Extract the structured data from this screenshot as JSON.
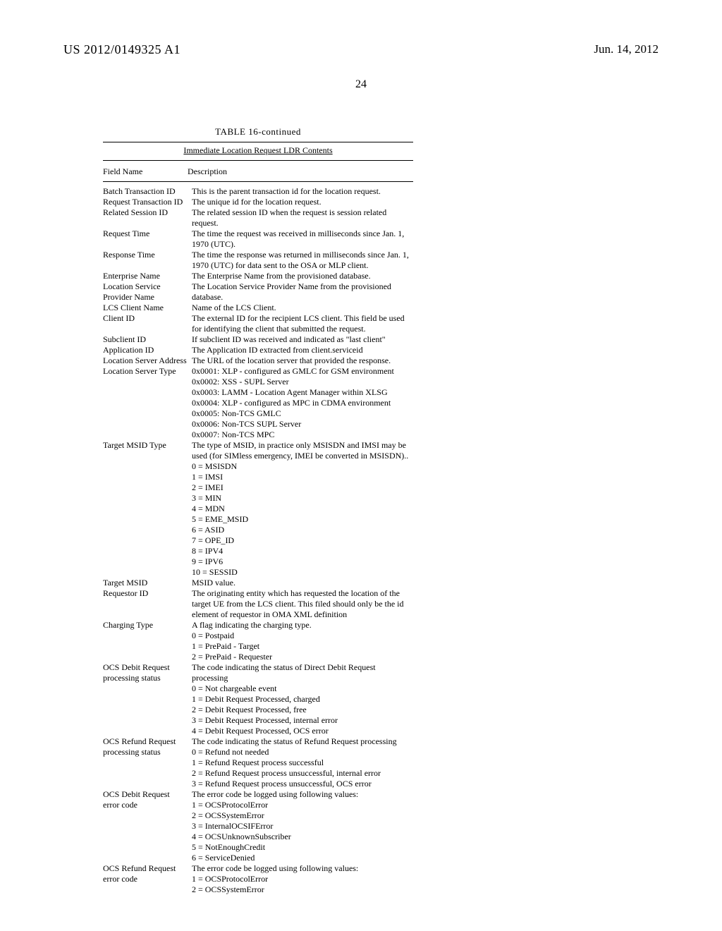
{
  "header": {
    "pubnum": "US 2012/0149325 A1",
    "date": "Jun. 14, 2012"
  },
  "page_number": "24",
  "table": {
    "title": "TABLE 16-continued",
    "subtitle": "Immediate Location Request LDR Contents",
    "col_field": "Field Name",
    "col_desc": "Description",
    "rows": [
      {
        "field": "Batch Transaction ID",
        "desc": "This is the parent transaction id for the location request."
      },
      {
        "field": "Request Transaction ID",
        "desc": "The unique id for the location request."
      },
      {
        "field": "Related Session ID",
        "desc": "The related session ID when the request is session related request."
      },
      {
        "field": "Request Time",
        "desc": "The time the request was received in milliseconds since Jan. 1, 1970 (UTC)."
      },
      {
        "field": "Response Time",
        "desc": "The time the response was returned in milliseconds since Jan. 1, 1970 (UTC) for data sent to the OSA or MLP client."
      },
      {
        "field": "Enterprise Name",
        "desc": "The Enterprise Name from the provisioned database."
      },
      {
        "field": "Location Service Provider Name",
        "desc": "The Location Service Provider Name from the provisioned database."
      },
      {
        "field": "LCS Client Name",
        "desc": "Name of the LCS Client."
      },
      {
        "field": "Client ID",
        "desc": "The external ID for the recipient LCS client. This field be used for identifying the client that submitted the request."
      },
      {
        "field": "Subclient ID",
        "desc": "If subclient ID was received and indicated as \"last client\""
      },
      {
        "field": "Application ID",
        "desc": "The Application ID extracted from client.serviceid"
      },
      {
        "field": "Location Server Address",
        "desc": "The URL of the location server that provided the response."
      },
      {
        "field": "Location Server Type",
        "desc": "0x0001: XLP - configured as GMLC for GSM environment\n0x0002: XSS - SUPL Server\n0x0003: LAMM - Location Agent Manager within XLSG\n0x0004: XLP - configured as MPC in CDMA environment\n0x0005: Non-TCS GMLC\n0x0006: Non-TCS SUPL Server\n0x0007: Non-TCS MPC"
      },
      {
        "field": "Target MSID Type",
        "desc": "The type of MSID, in practice only MSISDN and IMSI may be used (for SIMless emergency, IMEI be converted in MSISDN)..\n0 = MSISDN\n1 = IMSI\n2 = IMEI\n3 = MIN\n4 = MDN\n5 = EME_MSID\n6 = ASID\n7 = OPE_ID\n8 = IPV4\n9 = IPV6\n10 = SESSID"
      },
      {
        "field": "Target MSID",
        "desc": "MSID value."
      },
      {
        "field": "Requestor ID",
        "desc": "The originating entity which has requested the location of the target UE from the LCS client. This filed should only be the id element of requestor in OMA XML definition"
      },
      {
        "field": "Charging Type",
        "desc": "A flag indicating the charging type.\n0 = Postpaid\n1 = PrePaid - Target\n2 = PrePaid - Requester"
      },
      {
        "field": "OCS Debit Request processing status",
        "desc": "The code indicating the status of Direct Debit Request processing\n0 = Not chargeable event\n1 = Debit Request Processed, charged\n2 = Debit Request Processed, free\n3 = Debit Request Processed, internal error\n4 = Debit Request Processed, OCS error"
      },
      {
        "field": "OCS Refund Request processing status",
        "desc": "The code indicating the status of Refund Request processing\n0 = Refund not needed\n1 = Refund Request process successful\n2 = Refund Request process unsuccessful, internal error\n3 = Refund Request process unsuccessful, OCS error"
      },
      {
        "field": "OCS Debit Request error code",
        "desc": "The error code be logged using following values:\n1 = OCSProtocolError\n2 = OCSSystemError\n3 = InternalOCSIFError\n4 = OCSUnknownSubscriber\n5 = NotEnoughCredit\n6 = ServiceDenied"
      },
      {
        "field": "OCS Refund Request error code",
        "desc": "The error code be logged using following values:\n1 = OCSProtocolError\n2 = OCSSystemError"
      }
    ]
  }
}
